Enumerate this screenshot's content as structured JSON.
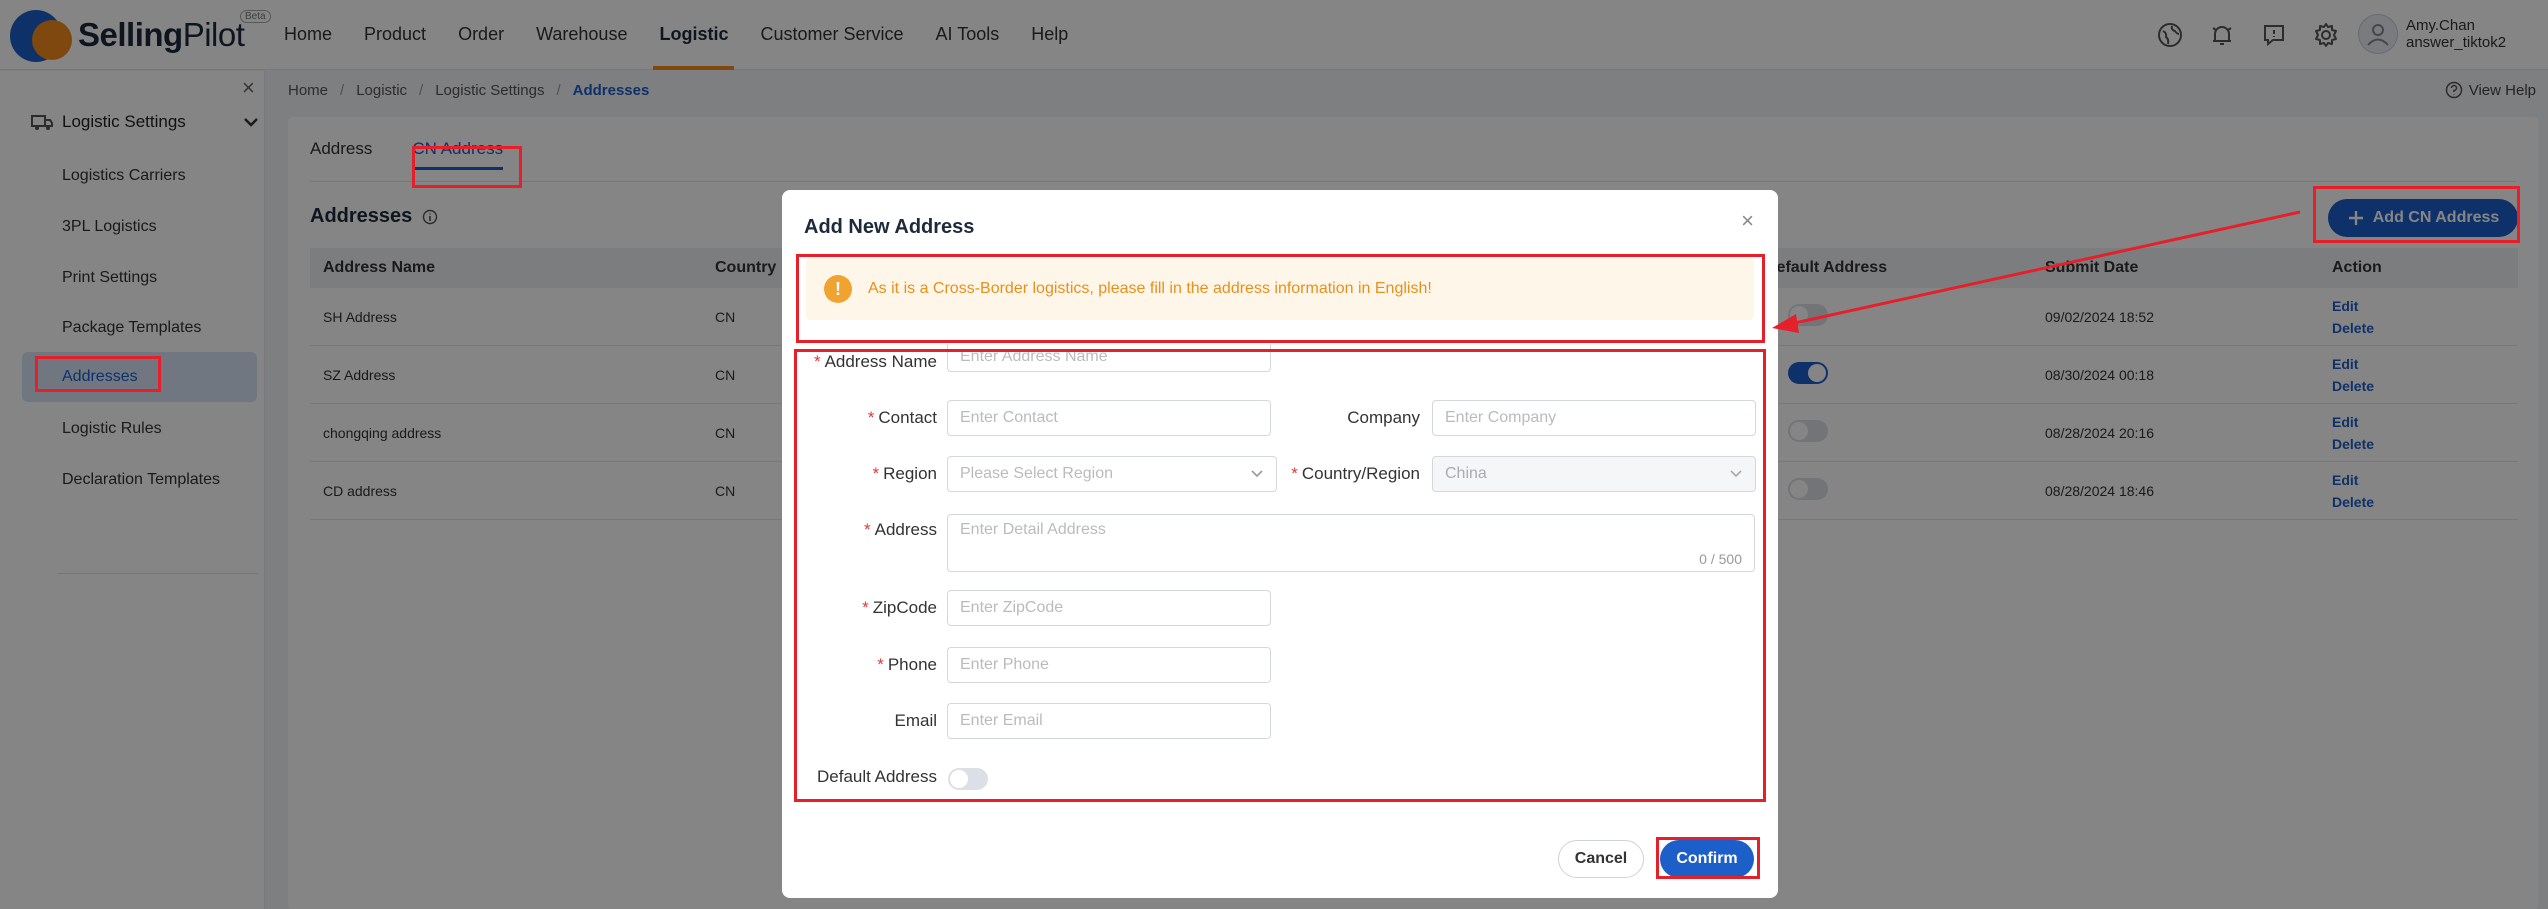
{
  "app": {
    "logo_text_bold": "Selling",
    "logo_text_light": "Pilot",
    "beta": "Beta"
  },
  "nav": {
    "items": [
      "Home",
      "Product",
      "Order",
      "Warehouse",
      "Logistic",
      "Customer Service",
      "AI Tools",
      "Help"
    ],
    "active": "Logistic"
  },
  "user": {
    "name": "Amy.Chan",
    "store": "answer_tiktok2"
  },
  "sidebar": {
    "group": "Logistic Settings",
    "items": [
      "Logistics Carriers",
      "3PL Logistics",
      "Print Settings",
      "Package Templates",
      "Addresses",
      "Logistic Rules",
      "Declaration Templates"
    ],
    "active": "Addresses"
  },
  "breadcrumb": [
    "Home",
    "Logistic",
    "Logistic Settings",
    "Addresses"
  ],
  "view_help": "View Help",
  "tabs": [
    "Address",
    "CN Address"
  ],
  "section_title": "Addresses",
  "add_button": "Add CN Address",
  "table": {
    "headers": [
      "Address Name",
      "Country",
      "Default Address",
      "Submit Date",
      "Action"
    ],
    "rows": [
      {
        "name": "SH Address",
        "country": "CN",
        "default": false,
        "date": "09/02/2024 18:52"
      },
      {
        "name": "SZ Address",
        "country": "CN",
        "default": true,
        "date": "08/30/2024 00:18"
      },
      {
        "name": "chongqing address",
        "country": "CN",
        "default": false,
        "date": "08/28/2024 20:16"
      },
      {
        "name": "CD address",
        "country": "CN",
        "default": false,
        "date": "08/28/2024 18:46"
      }
    ],
    "actions": {
      "edit": "Edit",
      "delete": "Delete"
    }
  },
  "modal": {
    "title": "Add New Address",
    "warning": "As it is a Cross-Border logistics, please fill in the address information in English!",
    "fields": {
      "address_name": {
        "label": "Address Name",
        "placeholder": "Enter Address Name"
      },
      "contact": {
        "label": "Contact",
        "placeholder": "Enter Contact"
      },
      "company": {
        "label": "Company",
        "placeholder": "Enter Company"
      },
      "region": {
        "label": "Region",
        "placeholder": "Please Select Region"
      },
      "country_region": {
        "label": "Country/Region",
        "value": "China"
      },
      "address": {
        "label": "Address",
        "placeholder": "Enter Detail Address",
        "count": "0 / 500"
      },
      "zipcode": {
        "label": "ZipCode",
        "placeholder": "Enter ZipCode"
      },
      "phone": {
        "label": "Phone",
        "placeholder": "Enter Phone"
      },
      "email": {
        "label": "Email",
        "placeholder": "Enter Email"
      },
      "default_address": {
        "label": "Default Address",
        "value": false
      }
    },
    "cancel": "Cancel",
    "confirm": "Confirm"
  },
  "colors": {
    "primary": "#1d5fc9",
    "accent": "#f28b1d",
    "annotation": "#e5202b",
    "warning": "#e8901c"
  }
}
